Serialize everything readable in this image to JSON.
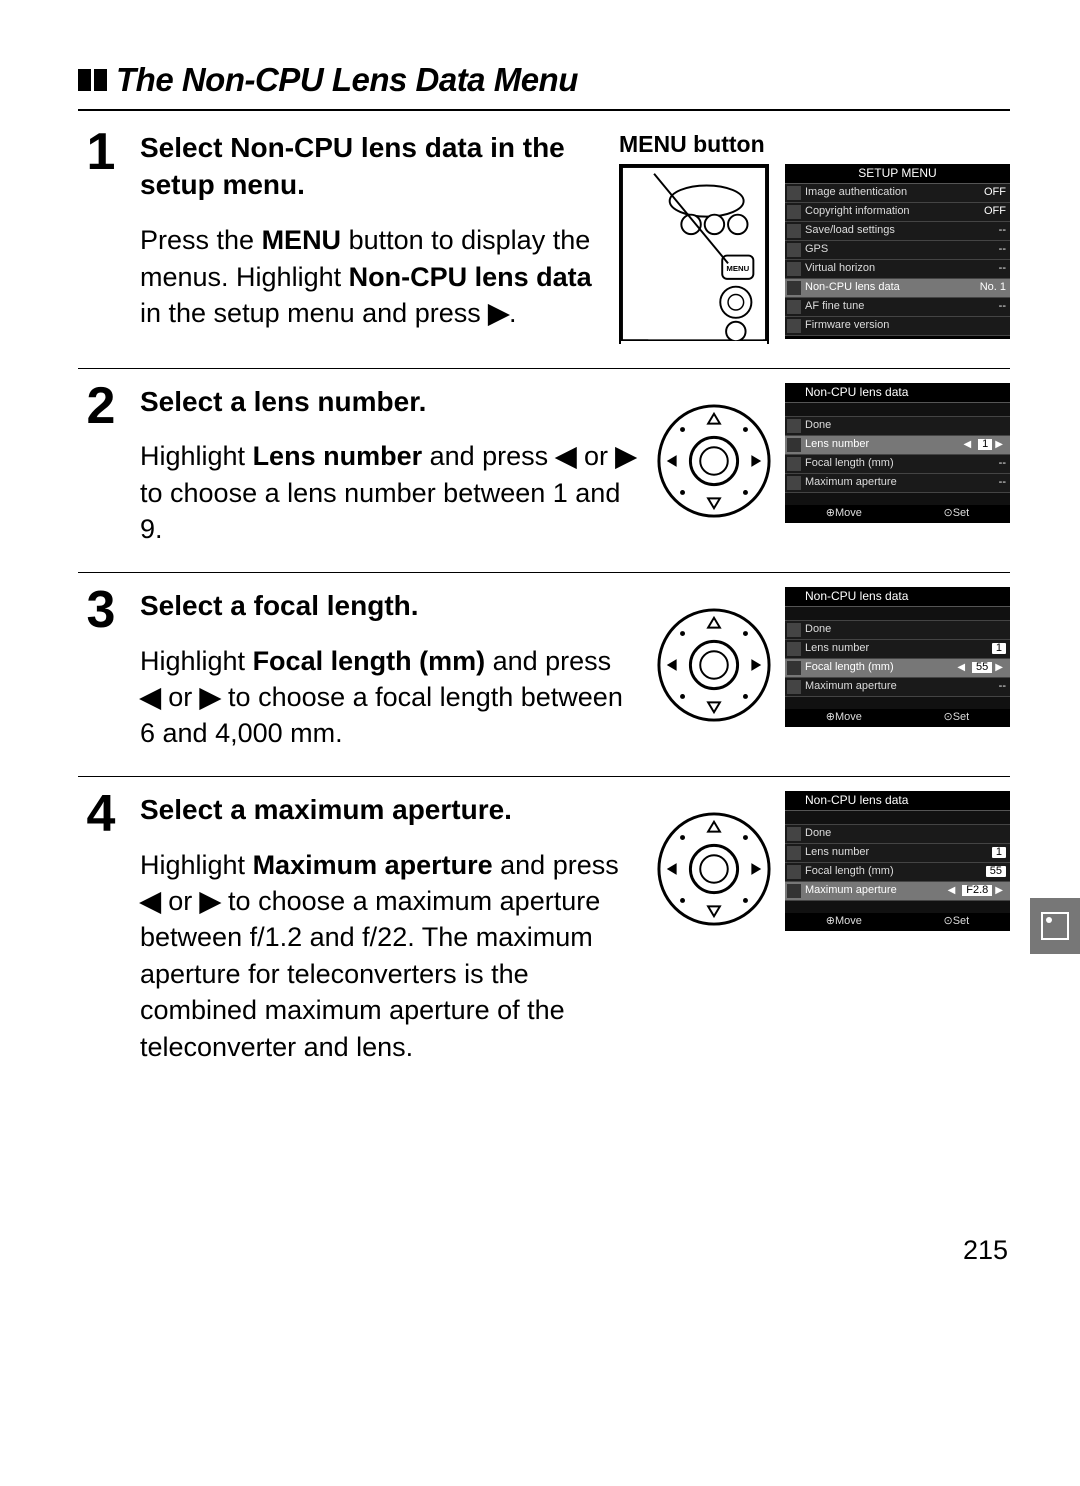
{
  "page_number": "215",
  "title": "The Non-CPU Lens Data Menu",
  "step1": {
    "num": "1",
    "heading_a": "Select ",
    "heading_b": "Non-CPU lens data",
    "heading_c": " in the setup menu.",
    "right_label_a": "MENU",
    "right_label_b": " button",
    "text_a": "Press the ",
    "text_menu": "MENU",
    "text_b": " button to display the menus. Highlight ",
    "text_bold": "Non-CPU lens data",
    "text_c": " in the setup menu and press ",
    "text_arrow": "▶",
    "text_d": ".",
    "lcd_title": "SETUP MENU",
    "rows": [
      {
        "label": "Image authentication",
        "val": "OFF"
      },
      {
        "label": "Copyright information",
        "val": "OFF"
      },
      {
        "label": "Save/load settings",
        "val": "--"
      },
      {
        "label": "GPS",
        "val": "--"
      },
      {
        "label": "Virtual horizon",
        "val": "--"
      },
      {
        "label": "Non-CPU lens data",
        "val": "No. 1",
        "sel": true
      },
      {
        "label": "AF fine tune",
        "val": "--"
      },
      {
        "label": "Firmware version",
        "val": ""
      }
    ]
  },
  "step2": {
    "num": "2",
    "heading": "Select a lens number.",
    "text_a": "Highlight ",
    "text_bold": "Lens number",
    "text_b": " and press ",
    "arrow_l": "◀",
    "text_c": " or ",
    "arrow_r": "▶",
    "text_d": " to choose a lens number between 1 and 9.",
    "lcd_title": "Non-CPU lens data",
    "rows": [
      {
        "label": "Done",
        "val": ""
      },
      {
        "label": "Lens number",
        "val": "1",
        "sel": true,
        "lr": true
      },
      {
        "label": "Focal length (mm)",
        "val": "--"
      },
      {
        "label": "Maximum aperture",
        "val": "--"
      }
    ],
    "foot_l": "Move",
    "foot_r": "Set"
  },
  "step3": {
    "num": "3",
    "heading": "Select a focal length.",
    "text_a": "Highlight ",
    "text_bold": "Focal length (mm)",
    "text_b": " and press ",
    "arrow_l": "◀",
    "text_c": " or ",
    "arrow_r": "▶",
    "text_d": " to choose a focal length between 6 and 4,000 mm.",
    "lcd_title": "Non-CPU lens data",
    "rows": [
      {
        "label": "Done",
        "val": ""
      },
      {
        "label": "Lens number",
        "val": "1",
        "box": true
      },
      {
        "label": "Focal length (mm)",
        "val": "55",
        "sel": true,
        "lr": true
      },
      {
        "label": "Maximum aperture",
        "val": "--"
      }
    ],
    "foot_l": "Move",
    "foot_r": "Set"
  },
  "step4": {
    "num": "4",
    "heading": "Select a maximum aperture.",
    "text_a": "Highlight ",
    "text_bold": "Maximum aperture",
    "text_b": " and press ",
    "arrow_l": "◀",
    "text_c": " or ",
    "arrow_r": "▶",
    "text_d": " to choose a maximum aperture between f/1.2 and f/22.  The maximum aperture for teleconverters is the combined maximum aperture of the teleconverter and lens.",
    "lcd_title": "Non-CPU lens data",
    "rows": [
      {
        "label": "Done",
        "val": ""
      },
      {
        "label": "Lens number",
        "val": "1",
        "box": true
      },
      {
        "label": "Focal length (mm)",
        "val": "55",
        "box": true
      },
      {
        "label": "Maximum aperture",
        "val": "F2.8",
        "sel": true,
        "lr": true
      }
    ],
    "foot_l": "Move",
    "foot_r": "Set"
  }
}
